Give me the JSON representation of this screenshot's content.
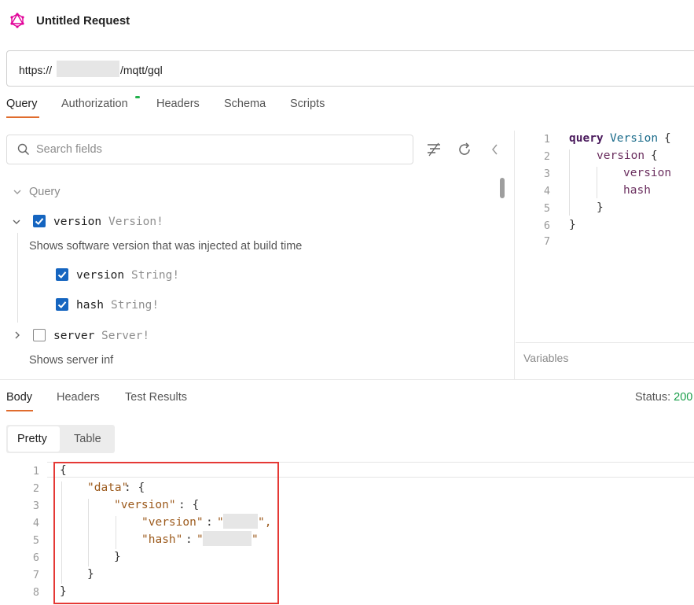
{
  "request": {
    "title": "Untitled Request",
    "icon": "graphql-icon",
    "url_prefix": "https://",
    "url_suffix": "/mqtt/gql",
    "tabs": [
      "Query",
      "Authorization",
      "Headers",
      "Schema",
      "Scripts"
    ],
    "active_tab": "Query"
  },
  "explorer": {
    "search_placeholder": "Search fields",
    "section_label": "Query",
    "fields": [
      {
        "name": "version",
        "type": "Version!",
        "checked": true,
        "expanded": true,
        "description": "Shows software version that was injected at build time",
        "children": [
          {
            "name": "version",
            "type": "String!",
            "checked": true
          },
          {
            "name": "hash",
            "type": "String!",
            "checked": true
          }
        ]
      },
      {
        "name": "server",
        "type": "Server!",
        "checked": false,
        "expanded": false,
        "description": "Shows server inf"
      }
    ]
  },
  "editor": {
    "line_numbers": [
      "1",
      "2",
      "3",
      "4",
      "5",
      "6",
      "7"
    ],
    "tokens": {
      "keyword": "query",
      "op_name": "Version",
      "open": "{",
      "close": "}",
      "field_version": "version",
      "field_version_inner": "version",
      "field_hash": "hash"
    },
    "variables_label": "Variables"
  },
  "response": {
    "tabs": [
      "Body",
      "Headers",
      "Test Results"
    ],
    "active_tab": "Body",
    "status_label": "Status:",
    "status_value": "200",
    "view_modes": [
      "Pretty",
      "Table"
    ],
    "active_view": "Pretty",
    "line_numbers": [
      "1",
      "2",
      "3",
      "4",
      "5",
      "6",
      "7",
      "8"
    ],
    "json_tokens": {
      "open": "{",
      "close": "}",
      "key_data": "\"data\"",
      "key_version_obj": "\"version\"",
      "key_version": "\"version\"",
      "key_hash": "\"hash\"",
      "colon_brace": ": {",
      "colon": ": ",
      "quote": "\"",
      "quote_comma": "\","
    }
  },
  "colors": {
    "accent_tab": "#e06c2d",
    "checkbox": "#1565c0",
    "status_ok": "#1a9e4a",
    "highlight_box": "#e53935",
    "brand_icon": "#e10098"
  }
}
